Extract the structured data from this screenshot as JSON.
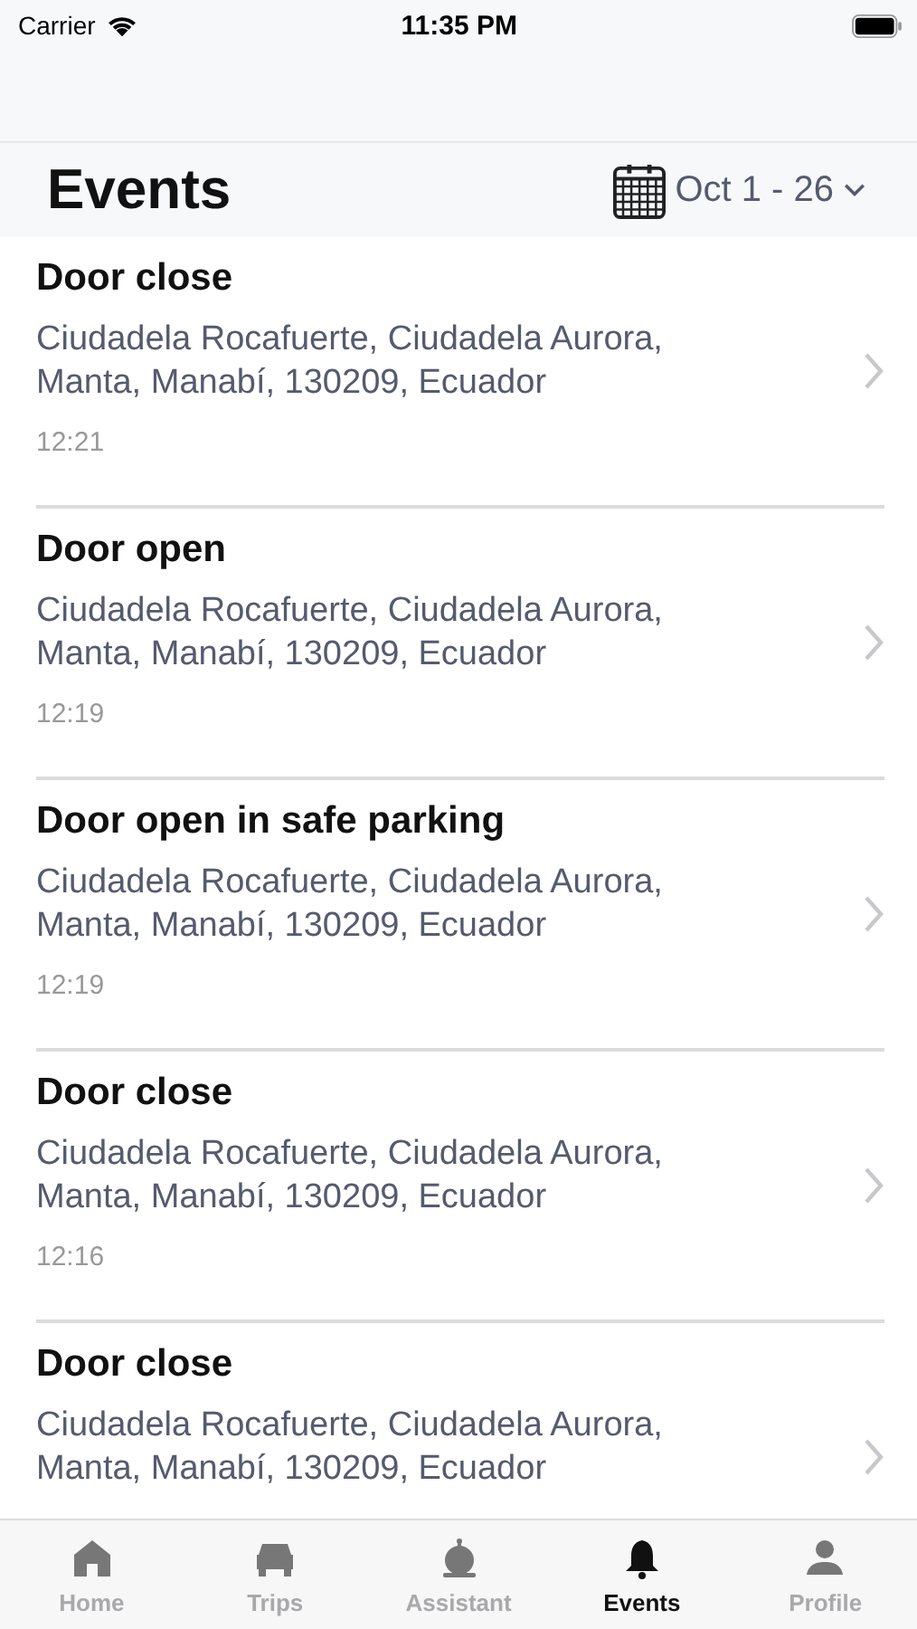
{
  "status_bar": {
    "carrier": "Carrier",
    "time": "11:35 PM"
  },
  "header": {
    "title": "Events",
    "date_range": "Oct 1 - 26"
  },
  "events": [
    {
      "title": "Door close",
      "address": "Ciudadela Rocafuerte, Ciudadela Aurora, Manta, Manabí, 130209, Ecuador",
      "time": "12:21"
    },
    {
      "title": "Door open",
      "address": "Ciudadela Rocafuerte, Ciudadela Aurora, Manta, Manabí, 130209, Ecuador",
      "time": "12:19"
    },
    {
      "title": "Door open in safe parking",
      "address": "Ciudadela Rocafuerte, Ciudadela Aurora, Manta, Manabí, 130209, Ecuador",
      "time": "12:19"
    },
    {
      "title": "Door close",
      "address": "Ciudadela Rocafuerte, Ciudadela Aurora, Manta, Manabí, 130209, Ecuador",
      "time": "12:16"
    },
    {
      "title": "Door close",
      "address": "Ciudadela Rocafuerte, Ciudadela Aurora, Manta, Manabí, 130209, Ecuador"
    }
  ],
  "tab_bar": [
    {
      "kind": "home",
      "label": "Home",
      "selected": false
    },
    {
      "kind": "car",
      "label": "Trips",
      "selected": false
    },
    {
      "kind": "robot",
      "label": "Assistant",
      "selected": false
    },
    {
      "kind": "bell",
      "label": "Events",
      "selected": true
    },
    {
      "kind": "person",
      "label": "Profile",
      "selected": false
    }
  ]
}
